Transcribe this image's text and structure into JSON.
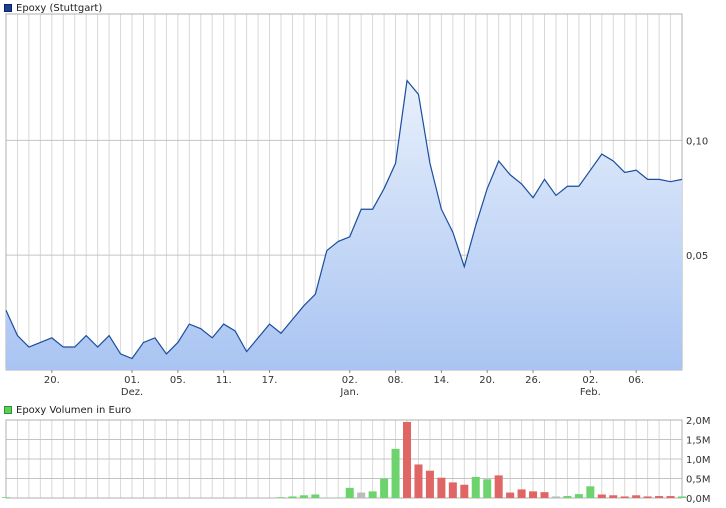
{
  "price_legend": {
    "label": "Epoxy (Stuttgart)",
    "color": "#1c3f94"
  },
  "volume_legend": {
    "label": "Epoxy Volumen in Euro",
    "color": "#5bcf5b"
  },
  "colors": {
    "line": "#1a4e9e",
    "fill_top": "#e8f0fc",
    "fill_bottom": "#a9c4f2",
    "grid": "#d8d8d8",
    "up": "#6dd46d",
    "down": "#e06666",
    "neutral": "#bbbbbb"
  },
  "chart_data": [
    {
      "type": "area",
      "series": [
        {
          "name": "Epoxy (Stuttgart)",
          "values": [
            0.026,
            0.015,
            0.01,
            0.012,
            0.014,
            0.01,
            0.01,
            0.015,
            0.01,
            0.015,
            0.007,
            0.005,
            0.012,
            0.014,
            0.007,
            0.012,
            0.02,
            0.018,
            0.014,
            0.02,
            0.017,
            0.008,
            0.014,
            0.02,
            0.016,
            0.022,
            0.028,
            0.033,
            0.052,
            0.056,
            0.058,
            0.07,
            0.07,
            0.079,
            0.09,
            0.126,
            0.12,
            0.09,
            0.07,
            0.06,
            0.045,
            0.063,
            0.079,
            0.091,
            0.085,
            0.081,
            0.075,
            0.083,
            0.076,
            0.08,
            0.08,
            0.087,
            0.094,
            0.091,
            0.086,
            0.087,
            0.083,
            0.083,
            0.082,
            0.083
          ]
        }
      ],
      "x_tick_labels": [
        {
          "label": "20.",
          "index": 4
        },
        {
          "label": "01.",
          "sublabel": "Dez.",
          "index": 11
        },
        {
          "label": "05.",
          "index": 15
        },
        {
          "label": "11.",
          "index": 19
        },
        {
          "label": "17.",
          "index": 23
        },
        {
          "label": "02.",
          "sublabel": "Jan.",
          "index": 30
        },
        {
          "label": "08.",
          "index": 34
        },
        {
          "label": "14.",
          "index": 38
        },
        {
          "label": "20.",
          "index": 42
        },
        {
          "label": "26.",
          "index": 46
        },
        {
          "label": "02.",
          "sublabel": "Feb.",
          "index": 51
        },
        {
          "label": "06.",
          "index": 55
        }
      ],
      "y_ticks": [
        {
          "value": 0.05,
          "label": "0,05"
        },
        {
          "value": 0.1,
          "label": "0,10"
        }
      ],
      "ylim": [
        0,
        0.155
      ],
      "grid": true
    },
    {
      "type": "bar",
      "series": [
        {
          "name": "Epoxy Volumen in Euro",
          "values": [
            0.02,
            0,
            0,
            0,
            0,
            0,
            0,
            0,
            0,
            0,
            0,
            0,
            0,
            0,
            0,
            0,
            0,
            0,
            0,
            0,
            0,
            0,
            0,
            0,
            0.02,
            0.04,
            0.07,
            0.09,
            0,
            0.01,
            0.26,
            0.14,
            0.17,
            0.5,
            1.26,
            1.95,
            0.86,
            0.7,
            0.52,
            0.4,
            0.34,
            0.54,
            0.48,
            0.58,
            0.14,
            0.22,
            0.17,
            0.15,
            0.04,
            0.05,
            0.1,
            0.3,
            0.09,
            0.07,
            0.04,
            0.07,
            0.04,
            0.05,
            0.05,
            0.04
          ],
          "directions": [
            "u",
            "n",
            "n",
            "n",
            "n",
            "n",
            "n",
            "n",
            "n",
            "n",
            "n",
            "n",
            "n",
            "n",
            "n",
            "n",
            "n",
            "n",
            "n",
            "n",
            "n",
            "n",
            "n",
            "n",
            "u",
            "u",
            "u",
            "u",
            "n",
            "u",
            "u",
            "n",
            "u",
            "u",
            "u",
            "d",
            "d",
            "d",
            "d",
            "d",
            "d",
            "u",
            "u",
            "d",
            "d",
            "d",
            "d",
            "d",
            "n",
            "u",
            "u",
            "u",
            "d",
            "d",
            "d",
            "d",
            "d",
            "d",
            "d",
            "u"
          ]
        }
      ],
      "y_ticks": [
        {
          "value": 0,
          "label": "0,0M"
        },
        {
          "value": 0.5,
          "label": "0,5M"
        },
        {
          "value": 1.0,
          "label": "1,0M"
        },
        {
          "value": 1.5,
          "label": "1,5M"
        },
        {
          "value": 2.0,
          "label": "2,0M"
        }
      ],
      "ylim": [
        0,
        2.0
      ],
      "grid": true
    }
  ]
}
